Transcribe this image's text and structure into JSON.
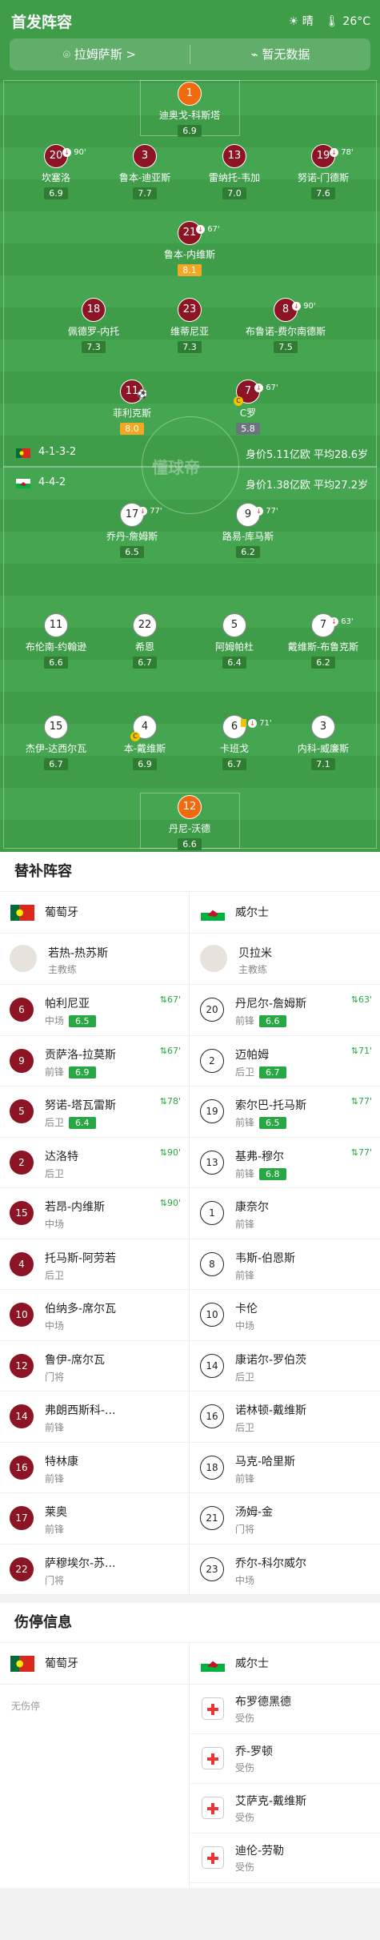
{
  "header": {
    "title": "首发阵容",
    "weather": "晴",
    "temp": "26°C"
  },
  "venue": {
    "stadium": "拉姆萨斯 >",
    "nodata": "暂无数据"
  },
  "home": {
    "form": "4-1-3-2",
    "meta": "身价5.11亿欧  平均28.6岁",
    "players": [
      {
        "num": "1",
        "name": "迪奥戈-科斯塔",
        "rating": "6.9"
      },
      {
        "num": "20",
        "name": "坎塞洛",
        "rating": "6.9",
        "evt": "90'"
      },
      {
        "num": "3",
        "name": "鲁本-迪亚斯",
        "rating": "7.7"
      },
      {
        "num": "13",
        "name": "雷纳托-韦加",
        "rating": "7.0"
      },
      {
        "num": "19",
        "name": "努诺-门德斯",
        "rating": "7.6",
        "evt": "78'"
      },
      {
        "num": "21",
        "name": "鲁本-内维斯",
        "rating": "8.1",
        "evt": "67'"
      },
      {
        "num": "18",
        "name": "佩德罗-内托",
        "rating": "7.3"
      },
      {
        "num": "23",
        "name": "维蒂尼亚",
        "rating": "7.3"
      },
      {
        "num": "8",
        "name": "布鲁诺-费尔南德斯",
        "rating": "7.5",
        "evt": "90'"
      },
      {
        "num": "11",
        "name": "菲利克斯",
        "rating": "8.0"
      },
      {
        "num": "7",
        "name": "C罗",
        "rating": "5.8",
        "evt": "67'"
      }
    ]
  },
  "away": {
    "form": "4-4-2",
    "meta": "身价1.38亿欧  平均27.2岁",
    "players": [
      {
        "num": "17",
        "name": "乔丹-詹姆斯",
        "rating": "6.5",
        "evt": "77'"
      },
      {
        "num": "9",
        "name": "路易-库马斯",
        "rating": "6.2",
        "evt": "77'"
      },
      {
        "num": "11",
        "name": "布伦南-约翰逊",
        "rating": "6.6"
      },
      {
        "num": "22",
        "name": "希恩",
        "rating": "6.7"
      },
      {
        "num": "5",
        "name": "阿姆帕杜",
        "rating": "6.4"
      },
      {
        "num": "7",
        "name": "戴维斯-布鲁克斯",
        "rating": "6.2",
        "evt": "63'"
      },
      {
        "num": "15",
        "name": "杰伊-达西尔瓦",
        "rating": "6.7"
      },
      {
        "num": "4",
        "name": "本-戴维斯",
        "rating": "6.9"
      },
      {
        "num": "6",
        "name": "卡班戈",
        "rating": "6.7",
        "evt": "71'"
      },
      {
        "num": "3",
        "name": "内科-威廉斯",
        "rating": "7.1"
      },
      {
        "num": "12",
        "name": "丹尼-沃德",
        "rating": "6.6"
      }
    ]
  },
  "watermark": "懂球帝",
  "subs": {
    "title": "替补阵容",
    "home_team": "葡萄牙",
    "away_team": "威尔士",
    "home_coach": {
      "name": "若热-热苏斯",
      "role": "主教练"
    },
    "away_coach": {
      "name": "贝拉米",
      "role": "主教练"
    },
    "home": [
      {
        "num": "6",
        "name": "帕利尼亚",
        "pos": "中场",
        "rating": "6.5",
        "time": "67'"
      },
      {
        "num": "9",
        "name": "贡萨洛-拉莫斯",
        "pos": "前锋",
        "rating": "6.9",
        "time": "67'"
      },
      {
        "num": "5",
        "name": "努诺-塔瓦雷斯",
        "pos": "后卫",
        "rating": "6.4",
        "time": "78'"
      },
      {
        "num": "2",
        "name": "达洛特",
        "pos": "后卫",
        "time": "90'"
      },
      {
        "num": "15",
        "name": "若昂-内维斯",
        "pos": "中场",
        "time": "90'"
      },
      {
        "num": "4",
        "name": "托马斯-阿劳若",
        "pos": "后卫"
      },
      {
        "num": "10",
        "name": "伯纳多-席尔瓦",
        "pos": "中场"
      },
      {
        "num": "12",
        "name": "鲁伊-席尔瓦",
        "pos": "门将"
      },
      {
        "num": "14",
        "name": "弗朗西斯科-...",
        "pos": "前锋"
      },
      {
        "num": "16",
        "name": "特林康",
        "pos": "前锋"
      },
      {
        "num": "17",
        "name": "莱奥",
        "pos": "前锋"
      },
      {
        "num": "22",
        "name": "萨穆埃尔-苏...",
        "pos": "门将"
      }
    ],
    "away": [
      {
        "num": "20",
        "name": "丹尼尔-詹姆斯",
        "pos": "前锋",
        "rating": "6.6",
        "time": "63'"
      },
      {
        "num": "2",
        "name": "迈帕姆",
        "pos": "后卫",
        "rating": "6.7",
        "time": "71'"
      },
      {
        "num": "19",
        "name": "索尔巴-托马斯",
        "pos": "前锋",
        "rating": "6.5",
        "time": "77'"
      },
      {
        "num": "13",
        "name": "基弗-穆尔",
        "pos": "前锋",
        "rating": "6.8",
        "time": "77'"
      },
      {
        "num": "1",
        "name": "康奈尔",
        "pos": "前锋"
      },
      {
        "num": "8",
        "name": "韦斯-伯恩斯",
        "pos": "前锋"
      },
      {
        "num": "10",
        "name": "卡伦",
        "pos": "中场"
      },
      {
        "num": "14",
        "name": "康诺尔-罗伯茨",
        "pos": "后卫"
      },
      {
        "num": "16",
        "name": "诺林顿-戴维斯",
        "pos": "后卫"
      },
      {
        "num": "18",
        "name": "马克-哈里斯",
        "pos": "前锋"
      },
      {
        "num": "21",
        "name": "汤姆-金",
        "pos": "门将"
      },
      {
        "num": "23",
        "name": "乔尔-科尔威尔",
        "pos": "中场"
      }
    ]
  },
  "injury": {
    "title": "伤停信息",
    "home_team": "葡萄牙",
    "away_team": "威尔士",
    "home_none": "无伤停",
    "away": [
      {
        "name": "布罗德黑德",
        "status": "受伤"
      },
      {
        "name": "乔-罗顿",
        "status": "受伤"
      },
      {
        "name": "艾萨克-戴维斯",
        "status": "受伤"
      },
      {
        "name": "迪伦-劳勒",
        "status": "受伤"
      }
    ]
  },
  "colors": {
    "pitch": "#3f9d4a",
    "home": "#8c1424",
    "gk": "#f26a10",
    "rating": "#2e7d32"
  }
}
